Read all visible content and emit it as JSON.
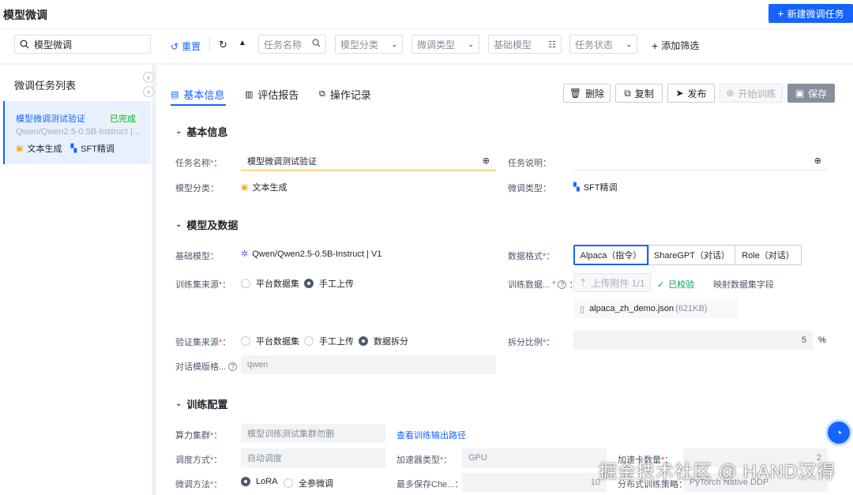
{
  "app": {
    "title": "模型微调",
    "new_button": "新建微调任务"
  },
  "filters": {
    "search_value": "模型微调",
    "reset": "重置",
    "task_name_placeholder": "任务名称",
    "model_category": "模型分类",
    "finetune_type": "微调类型",
    "base_model": "基础模型",
    "task_status": "任务状态",
    "add_filter": "添加筛选"
  },
  "sidebar": {
    "title": "微调任务列表",
    "item": {
      "name": "模型微调测试验证",
      "status": "已完成",
      "model": "Qwen/Qwen2.5-0.5B-Instruct |...",
      "tag1": "文本生成",
      "tag2": "SFT精调"
    }
  },
  "tabs": [
    {
      "label": "基本信息"
    },
    {
      "label": "评估报告"
    },
    {
      "label": "操作记录"
    }
  ],
  "actions": {
    "delete": "删除",
    "copy": "复制",
    "publish": "发布",
    "start": "开始训练",
    "save": "保存"
  },
  "basic": {
    "section": "基本信息",
    "task_name_label": "任务名称",
    "task_name_value": "模型微调测试验证",
    "task_desc_label": "任务说明",
    "category_label": "模型分类",
    "category_value": "文本生成",
    "type_label": "微调类型",
    "type_value": "SFT精调"
  },
  "model_data": {
    "section": "模型及数据",
    "base_model_label": "基础模型",
    "base_model_value": "Qwen/Qwen2.5-0.5B-Instruct | V1",
    "format_label": "数据格式",
    "formats": [
      "Alpaca（指令）",
      "ShareGPT（对话）",
      "Role（对话）"
    ],
    "train_source_label": "训练集来源",
    "platform_dataset": "平台数据集",
    "manual_upload": "手工上传",
    "train_data_label": "训练数据...",
    "upload_btn": "上传附件 1/1",
    "verified": "已校验",
    "map_fields": "映射数据集字段",
    "file_name": "alpaca_zh_demo.json",
    "file_size": "(621KB)",
    "val_source_label": "验证集来源",
    "data_split": "数据拆分",
    "split_ratio_label": "拆分比例",
    "split_ratio_value": "5",
    "split_unit": "%",
    "template_label": "对话模版格...",
    "template_value": "qwen"
  },
  "training": {
    "section": "训练配置",
    "cluster_label": "算力集群",
    "cluster_value": "模型训练测试集群勿删",
    "output_link": "查看训练输出路径",
    "schedule_label": "调度方式",
    "schedule_value": "自动调度",
    "accel_type_label": "加速器类型",
    "accel_type_value": "GPU",
    "accel_count_label": "加速卡数量",
    "accel_count_value": "2",
    "method_label": "微调方法",
    "method_lora": "LoRA",
    "method_full": "全参微调",
    "max_ckpt_label": "最多保存Che...",
    "max_ckpt_value": "10",
    "dist_label": "分布式训练策略",
    "dist_value": "PyTorch Native DDP"
  },
  "watermark": "掘金技术社区 @ HAND汉得"
}
